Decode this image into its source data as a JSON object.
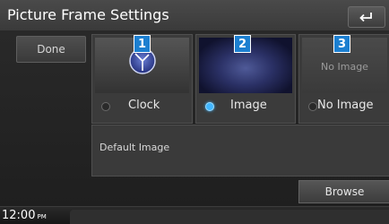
{
  "header": {
    "title": "Picture Frame Settings",
    "back_icon": "return-arrow-icon"
  },
  "sidebar": {
    "done_label": "Done"
  },
  "options": [
    {
      "number": "1",
      "label": "Clock",
      "selected": false,
      "thumb_icon": "analog-clock-icon"
    },
    {
      "number": "2",
      "label": "Image",
      "selected": true,
      "thumb_icon": "image-thumbnail"
    },
    {
      "number": "3",
      "label": "No Image",
      "selected": false,
      "thumb_text": "No Image"
    }
  ],
  "default_image": {
    "label": "Default Image",
    "browse_label": "Browse"
  },
  "status": {
    "time": "12:00",
    "ampm": "PM"
  },
  "colors": {
    "selected_radio": "#41b6ff",
    "badge": "#1c7fd0"
  }
}
